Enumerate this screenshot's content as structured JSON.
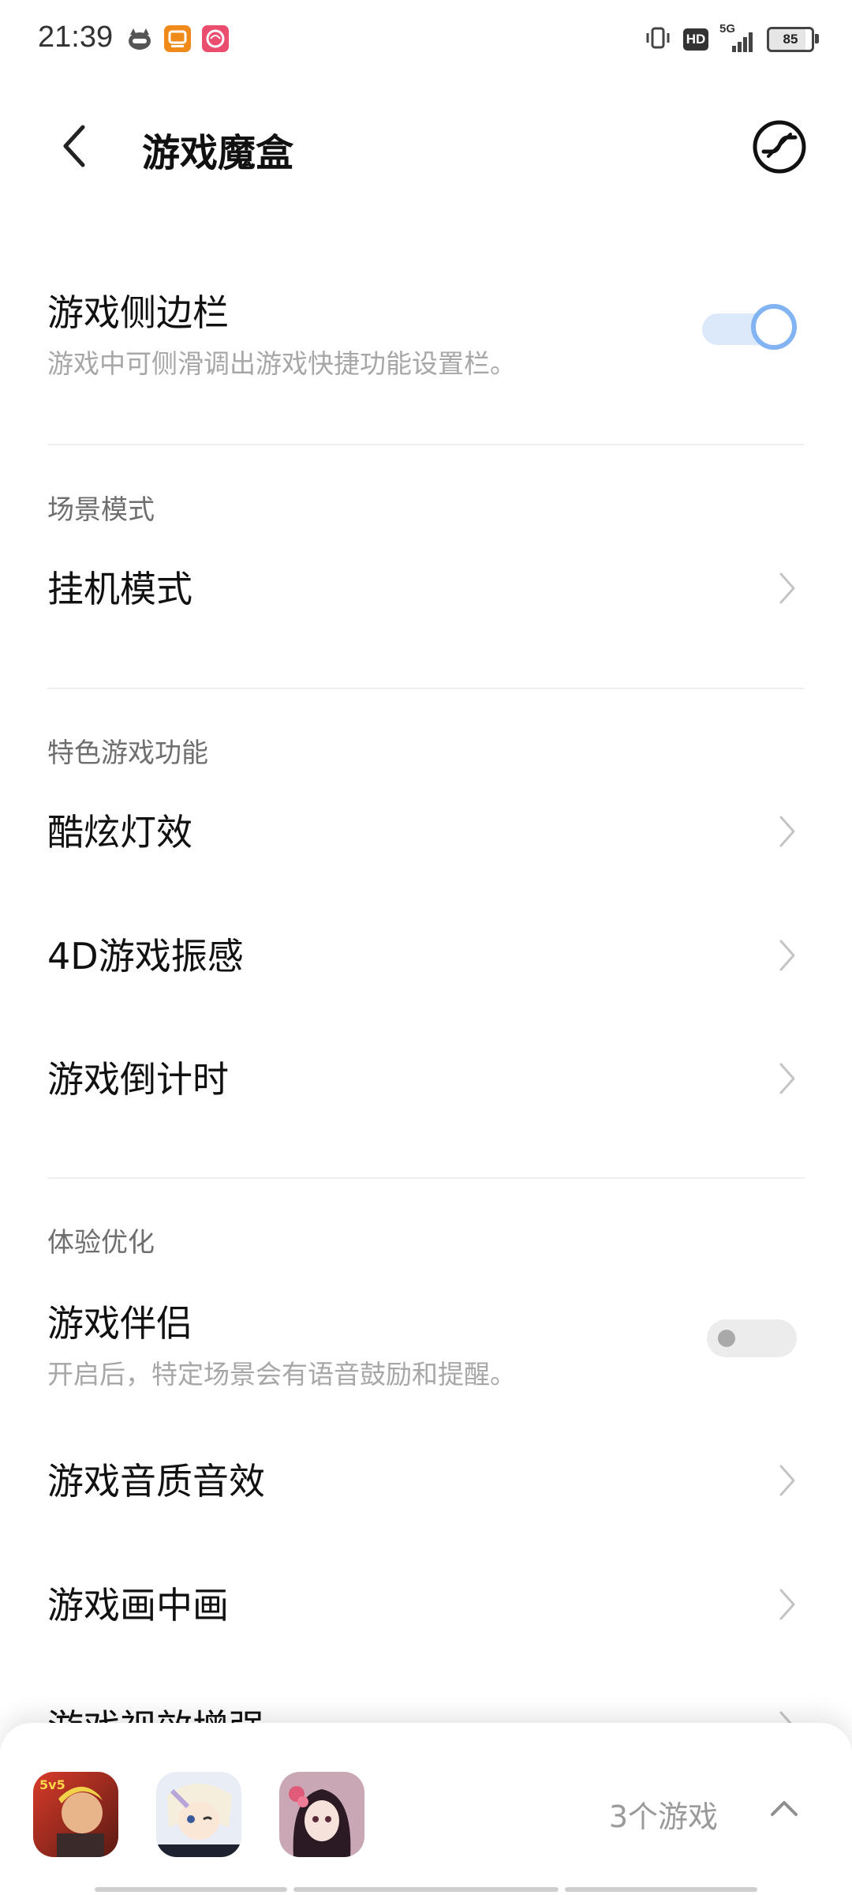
{
  "status_bar": {
    "time": "21:39",
    "hd_label": "HD",
    "network": "5G",
    "battery": "85"
  },
  "header": {
    "title": "游戏魔盒",
    "back_icon": "chevron-left-icon",
    "action_icon": "game-mode-icon"
  },
  "settings": {
    "sidebar": {
      "title": "游戏侧边栏",
      "subtitle": "游戏中可侧滑调出游戏快捷功能设置栏。",
      "enabled": true
    },
    "scene_section": {
      "label": "场景模式",
      "items": [
        {
          "label": "挂机模式"
        }
      ]
    },
    "feature_section": {
      "label": "特色游戏功能",
      "items": [
        {
          "label": "酷炫灯效"
        },
        {
          "label": "4D游戏振感"
        },
        {
          "label": "游戏倒计时"
        }
      ]
    },
    "experience_section": {
      "label": "体验优化",
      "companion": {
        "title": "游戏伴侣",
        "subtitle": "开启后，特定场景会有语音鼓励和提醒。",
        "enabled": false
      },
      "items": [
        {
          "label": "游戏音质音效"
        },
        {
          "label": "游戏画中画"
        },
        {
          "label": "游戏视效增强"
        }
      ]
    }
  },
  "game_tray": {
    "count_label": "3个游戏",
    "games": [
      "game-icon-1",
      "game-icon-2",
      "game-icon-3"
    ]
  },
  "colors": {
    "accent": "#82b4f3",
    "toggle_track_on": "#dbe9fb",
    "subtitle_text": "#a7a7a7"
  }
}
